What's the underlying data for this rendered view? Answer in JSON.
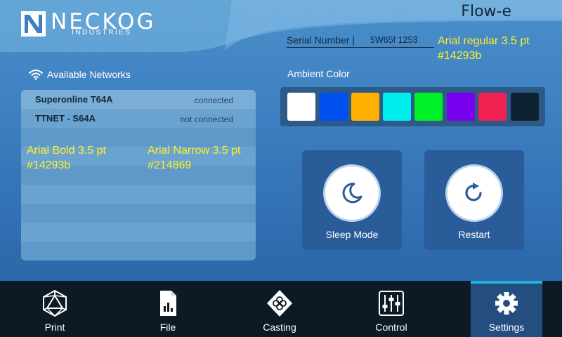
{
  "header": {
    "logo_name": "NECKOG",
    "logo_sub": "INDUSTRIES",
    "brand": "Flow-e",
    "serial_label": "Serial Number |",
    "serial_value": "5W65f 1253"
  },
  "annotations": {
    "serial_font": [
      "Arial regular 3.5 pt",
      "#14293b"
    ],
    "name_font": [
      "Arial Bold 3.5 pt",
      "#14293b"
    ],
    "status_font": [
      "Arial Narrow 3.5 pt",
      "#214869"
    ]
  },
  "networks": {
    "title": "Available Networks",
    "items": [
      {
        "name": "Superonline T64A",
        "status": "connected"
      },
      {
        "name": "TTNET - S64A",
        "status": "not connected"
      }
    ]
  },
  "ambient": {
    "title": "Ambient Color",
    "swatches": [
      "#ffffff",
      "#0050f0",
      "#ffb000",
      "#00eef0",
      "#00f028",
      "#7a00f0",
      "#f02050",
      "#0f2233"
    ]
  },
  "actions": {
    "sleep_label": "Sleep Mode",
    "restart_label": "Restart"
  },
  "nav": {
    "print": "Print",
    "file": "File",
    "casting": "Casting",
    "control": "Control",
    "settings": "Settings",
    "active": "settings"
  },
  "colors": {
    "text_dark": "#14293b",
    "status_text": "#214869",
    "note_yellow": "#fff02a",
    "active_indicator": "#1fb6d8"
  }
}
